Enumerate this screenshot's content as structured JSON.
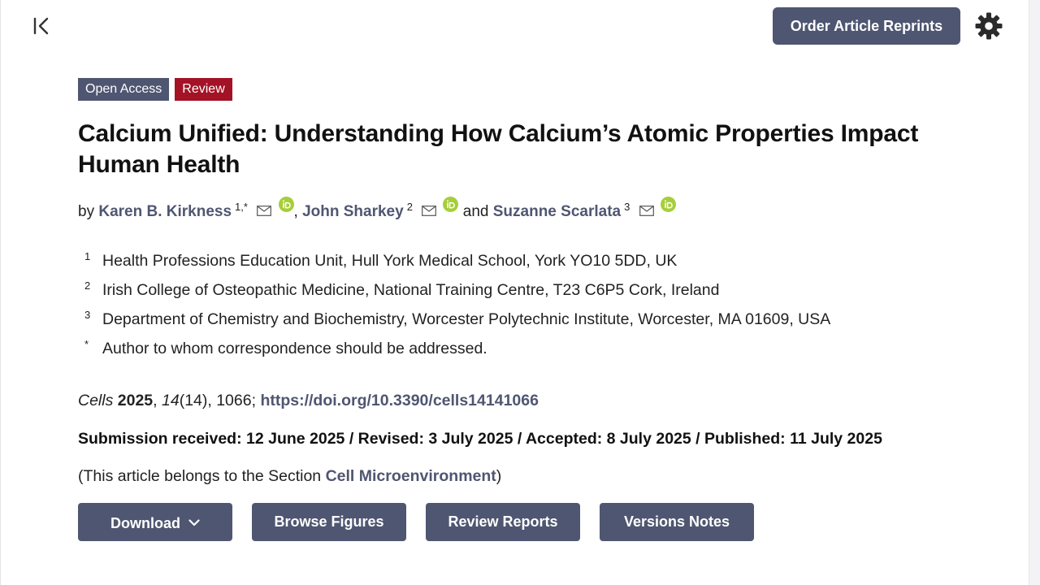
{
  "toolbar": {
    "collapse_icon": "collapse-left-icon",
    "reprints_label": "Order Article Reprints",
    "settings_icon": "gear-icon"
  },
  "badges": {
    "open_access": "Open Access",
    "review": "Review"
  },
  "article": {
    "title": "Calcium Unified: Understanding How Calcium’s Atomic Properties Impact Human Health",
    "by": "by",
    "and": "and",
    "authors": [
      {
        "name": "Karen B. Kirkness",
        "sup": "1,*"
      },
      {
        "name": "John Sharkey",
        "sup": "2"
      },
      {
        "name": "Suzanne Scarlata",
        "sup": "3"
      }
    ],
    "affiliations": [
      {
        "num": "1",
        "text": "Health Professions Education Unit, Hull York Medical School, York YO10 5DD, UK"
      },
      {
        "num": "2",
        "text": "Irish College of Osteopathic Medicine, National Training Centre, T23 C6P5 Cork, Ireland"
      },
      {
        "num": "3",
        "text": "Department of Chemistry and Biochemistry, Worcester Polytechnic Institute, Worcester, MA 01609, USA"
      },
      {
        "num": "*",
        "text": "Author to whom correspondence should be addressed."
      }
    ],
    "citation": {
      "journal": "Cells",
      "year": "2025",
      "volume": "14",
      "rest": "(14), 1066;",
      "doi": "https://doi.org/10.3390/cells14141066"
    },
    "dates": "Submission received: 12 June 2025 / Revised: 3 July 2025 / Accepted: 8 July 2025 / Published: 11 July 2025",
    "section": {
      "prefix": "(This article belongs to the Section ",
      "name": "Cell Microenvironment",
      "suffix": ")"
    }
  },
  "actions": {
    "download": "Download",
    "browse_figures": "Browse Figures",
    "review_reports": "Review Reports",
    "versions_notes": "Versions Notes"
  },
  "colors": {
    "brand": "#4f5671",
    "review_badge": "#a41225",
    "orcid": "#a6ce39"
  }
}
